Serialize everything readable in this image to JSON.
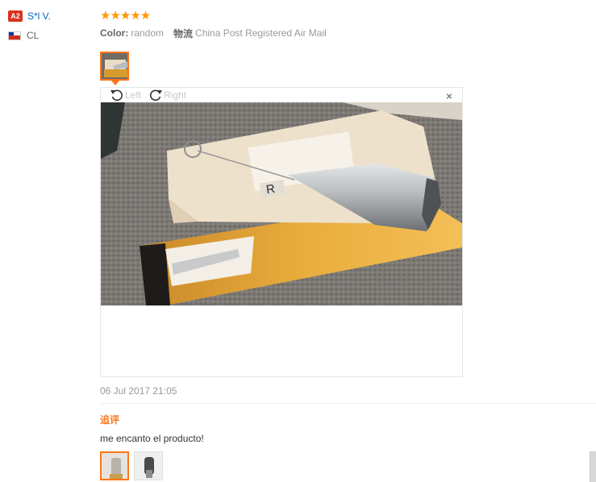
{
  "user": {
    "level_badge": "A2",
    "name": "S*l V.",
    "country_code": "CL"
  },
  "review": {
    "stars": "★★★★★",
    "rating": 5,
    "color_label": "Color:",
    "color_value": "random",
    "shipping_label": "物流",
    "shipping_value": "China Post Registered Air Mail",
    "viewer": {
      "rotate_left_label": "Left",
      "rotate_right_label": "Right",
      "close_glyph": "×"
    },
    "date": "06 Jul 2017 21:05"
  },
  "additional": {
    "title": "追评",
    "text": "me encanto el producto!"
  },
  "colors": {
    "accent": "#ff7519",
    "star": "#ff9900",
    "link": "#0066c0",
    "badge": "#d9331e"
  }
}
